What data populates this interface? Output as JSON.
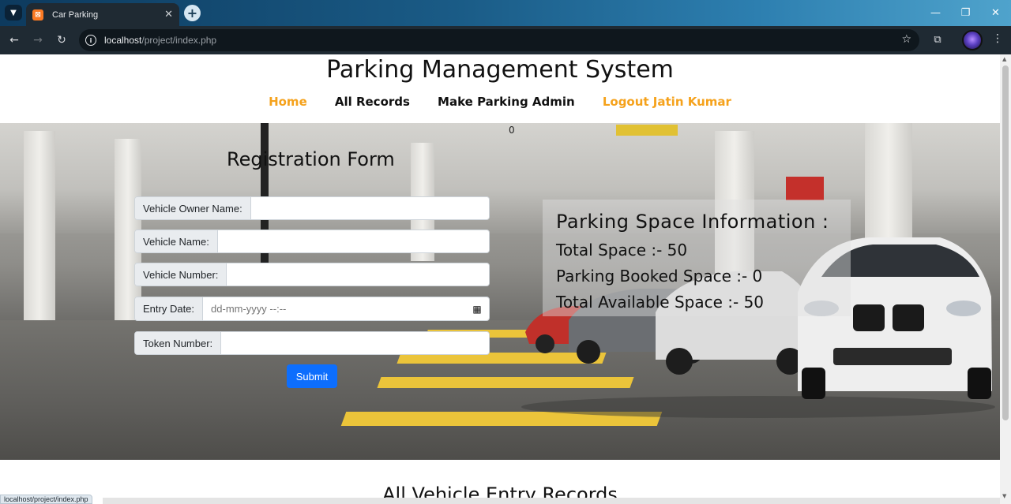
{
  "browser": {
    "tab_title": "Car Parking",
    "favicon_glyph": "⊠",
    "url_host": "localhost",
    "url_path": "/project/index.php",
    "status_url": "localhost/project/index.php"
  },
  "site": {
    "title": "Parking Management System",
    "nav": [
      {
        "label": "Home",
        "color": "#f5a21c"
      },
      {
        "label": "All Records",
        "color": "#111111"
      },
      {
        "label": "Make Parking Admin",
        "color": "#111111"
      },
      {
        "label": "Logout Jatin Kumar",
        "color": "#f5a21c"
      }
    ]
  },
  "hero": {
    "counter": "0",
    "form": {
      "title": "Registration Form",
      "fields": [
        {
          "label": "Vehicle Owner Name:",
          "value": "",
          "placeholder": ""
        },
        {
          "label": "Vehicle Name:",
          "value": "",
          "placeholder": ""
        },
        {
          "label": "Vehicle Number:",
          "value": "",
          "placeholder": ""
        },
        {
          "label": "Entry Date:",
          "value": "",
          "placeholder": "dd-mm-yyyy --:--"
        },
        {
          "label": "Token Number:",
          "value": "",
          "placeholder": ""
        }
      ],
      "submit_label": "Submit"
    },
    "info": {
      "heading": "Parking Space Information :",
      "total": "Total Space :- 50",
      "booked": "Parking Booked Space :- 0",
      "available": "Total Available Space :- 50"
    }
  },
  "records": {
    "title": "All Vehicle Entry Records"
  },
  "colors": {
    "accent_orange": "#f5a21c",
    "submit_blue": "#0d6efd"
  }
}
